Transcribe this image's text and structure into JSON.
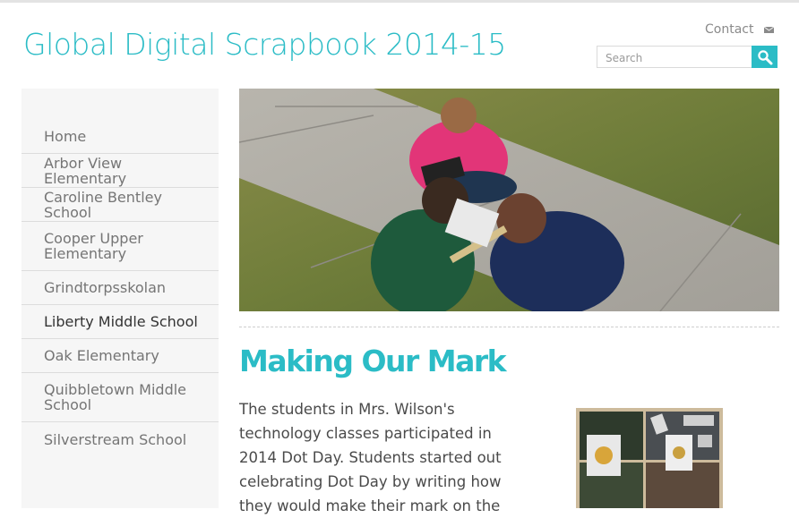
{
  "site": {
    "title": "Global Digital Scrapbook 2014-15"
  },
  "header": {
    "contact_label": "Contact",
    "mail_icon": "mail-icon"
  },
  "search": {
    "placeholder": "Search",
    "icon": "search-icon"
  },
  "nav": {
    "items": [
      {
        "label": "Home",
        "active": false
      },
      {
        "label": "Arbor View Elementary",
        "active": false
      },
      {
        "label": "Caroline Bentley School",
        "active": false
      },
      {
        "label": "Cooper Upper Elementary",
        "active": false
      },
      {
        "label": "Grindtorpsskolan",
        "active": false
      },
      {
        "label": "Liberty Middle School",
        "active": true
      },
      {
        "label": "Oak Elementary",
        "active": false
      },
      {
        "label": "Quibbletown Middle School",
        "active": false
      },
      {
        "label": "Silverstream School",
        "active": false
      }
    ]
  },
  "article": {
    "title": "Making Our Mark",
    "body": "The students in Mrs. Wilson's technology classes participated in 2014 Dot Day. Students started out celebrating Dot Day by writing how they would make their mark on the"
  },
  "colors": {
    "accent": "#2bbcc6",
    "nav_text": "#757575",
    "nav_active": "#333333",
    "sidebar_bg": "#f6f6f6"
  }
}
